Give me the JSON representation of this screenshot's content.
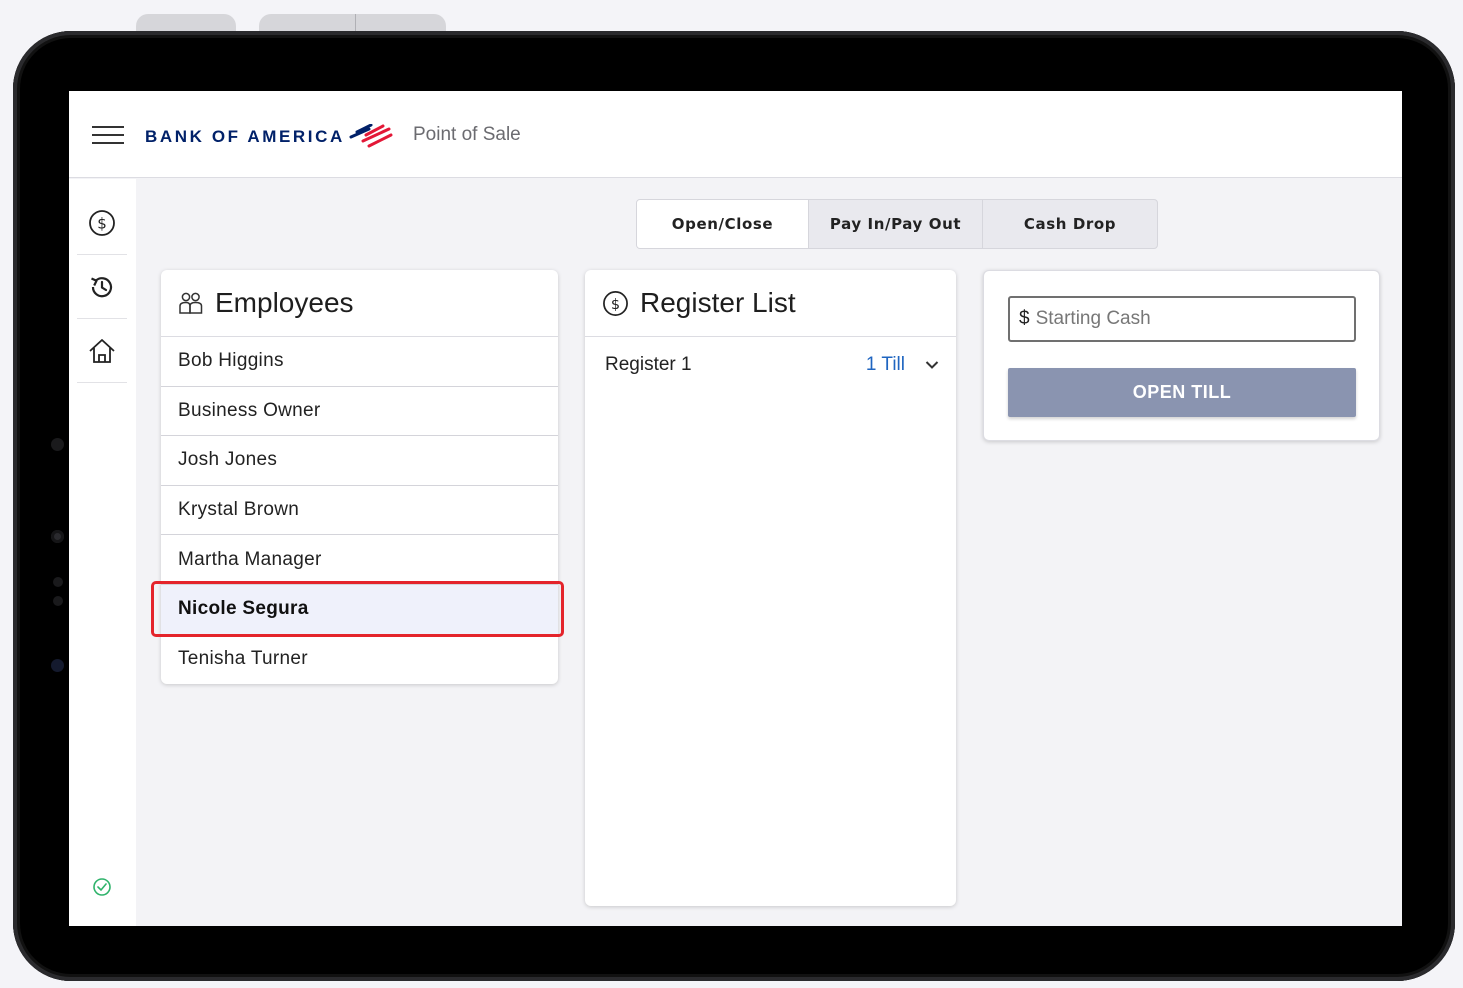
{
  "header": {
    "brand": "BANK OF AMERICA",
    "app_title": "Point of Sale"
  },
  "rail": {
    "items": [
      {
        "icon": "dollar-circle-icon"
      },
      {
        "icon": "history-icon"
      },
      {
        "icon": "home-icon"
      }
    ],
    "status_icon": "check-circle-icon",
    "status_color": "#2fb36b"
  },
  "tabs": [
    {
      "label": "Open/Close",
      "active": true
    },
    {
      "label": "Pay In/Pay Out",
      "active": false
    },
    {
      "label": "Cash Drop",
      "active": false
    }
  ],
  "employees": {
    "title": "Employees",
    "items": [
      {
        "name": "Bob Higgins"
      },
      {
        "name": "Business Owner"
      },
      {
        "name": "Josh Jones"
      },
      {
        "name": "Krystal Brown"
      },
      {
        "name": "Martha Manager"
      },
      {
        "name": "Nicole Segura",
        "selected": true
      },
      {
        "name": "Tenisha Turner"
      }
    ]
  },
  "registers": {
    "title": "Register List",
    "items": [
      {
        "name": "Register 1",
        "tills": "1 Till"
      }
    ]
  },
  "cash": {
    "currency": "$",
    "placeholder": "Starting Cash",
    "value": "",
    "button_label": "OPEN TILL"
  },
  "colors": {
    "brand_navy": "#012169",
    "brand_red": "#e31837",
    "button_disabled": "#8a94b0",
    "link_blue": "#1f65c0",
    "highlight_red": "#e4242b"
  }
}
